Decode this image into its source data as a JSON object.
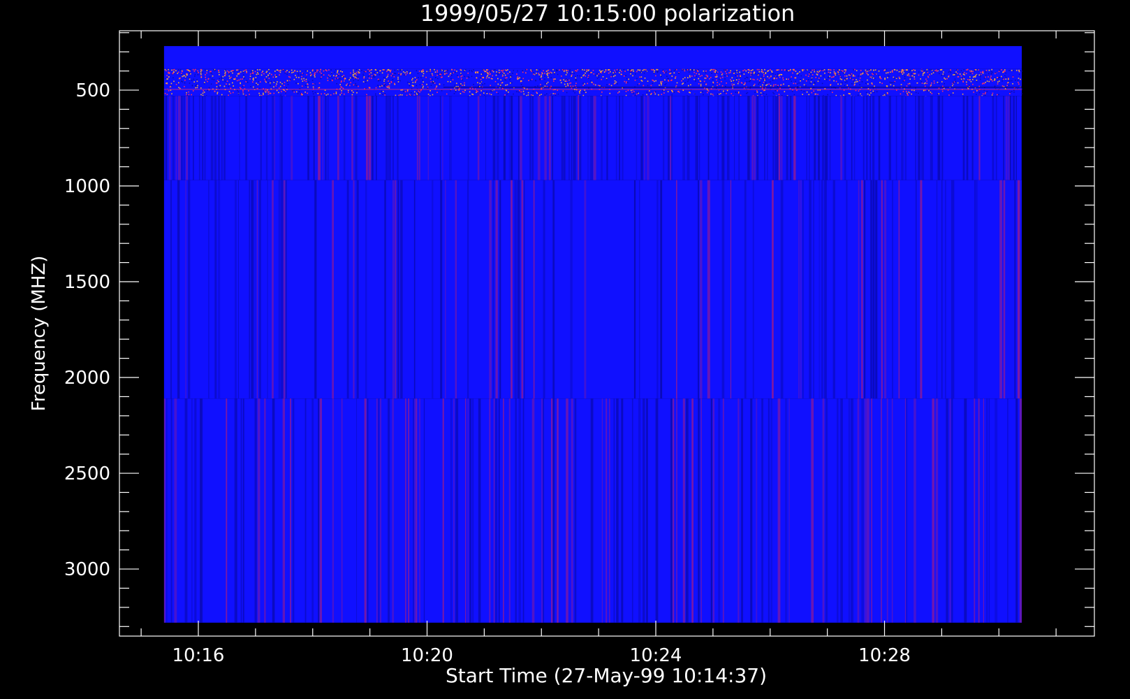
{
  "chart_data": {
    "type": "heatmap",
    "title": "1999/05/27 10:15:00 polarization",
    "xlabel": "Start Time (27-May-99 10:14:37)",
    "ylabel": "Frequency (MHZ)",
    "x_tick_labels": [
      "10:16",
      "10:20",
      "10:24",
      "10:28"
    ],
    "x_tick_values_min": [
      16,
      20,
      24,
      28
    ],
    "x_range_min": [
      14.62,
      31.67
    ],
    "x_data_range_min": [
      15.4,
      30.4
    ],
    "y_ticks": [
      500,
      1000,
      1500,
      2000,
      2500,
      3000
    ],
    "y_range": [
      190,
      3350
    ],
    "y_data_range": [
      270,
      3280
    ],
    "y_inverted": true,
    "bands": [
      {
        "from": 270,
        "to": 390,
        "pattern": "solid"
      },
      {
        "from": 390,
        "to": 530,
        "pattern": "speckled"
      },
      {
        "from": 530,
        "to": 970,
        "pattern": "streaked-dark"
      },
      {
        "from": 970,
        "to": 2110,
        "pattern": "streaked-faint"
      },
      {
        "from": 2110,
        "to": 3280,
        "pattern": "streaked-red"
      }
    ],
    "colors": {
      "background": "#000000",
      "base": "#1010ff",
      "dark": "#0a0ab0",
      "red": "#8a1a9a",
      "speckle_warm": "#ffb030",
      "speckle_red": "#ff3060",
      "axes": "#ffffff"
    }
  }
}
